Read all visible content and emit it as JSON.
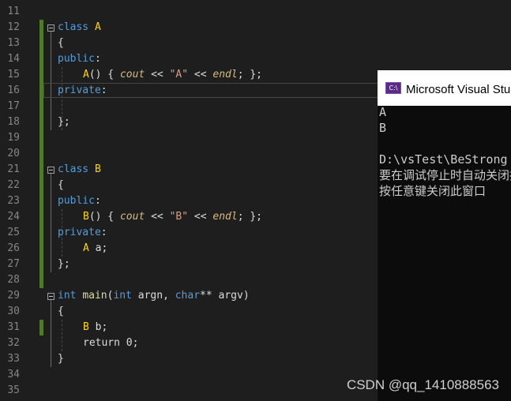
{
  "editor": {
    "lines": [
      {
        "num": "11"
      },
      {
        "num": "12",
        "tokens": [
          [
            "kw",
            "class"
          ],
          [
            "pn",
            " "
          ],
          [
            "yellow",
            "A"
          ]
        ]
      },
      {
        "num": "13",
        "tokens": [
          [
            "pn",
            "{"
          ]
        ]
      },
      {
        "num": "14",
        "tokens": [
          [
            "kw",
            "public"
          ],
          [
            "pn",
            ":"
          ]
        ]
      },
      {
        "num": "15",
        "tokens": [
          [
            "yellow",
            "A"
          ],
          [
            "pn",
            "() { "
          ],
          [
            "it",
            "cout"
          ],
          [
            "pn",
            " << "
          ],
          [
            "str",
            "\"A\""
          ],
          [
            "pn",
            " << "
          ],
          [
            "it",
            "endl"
          ],
          [
            "pn",
            "; };"
          ]
        ],
        "indent": 2
      },
      {
        "num": "16",
        "tokens": [
          [
            "kw",
            "private"
          ],
          [
            "pn",
            ":"
          ]
        ]
      },
      {
        "num": "17"
      },
      {
        "num": "18",
        "tokens": [
          [
            "pn",
            "};"
          ]
        ]
      },
      {
        "num": "19"
      },
      {
        "num": "20"
      },
      {
        "num": "21",
        "tokens": [
          [
            "kw",
            "class"
          ],
          [
            "pn",
            " "
          ],
          [
            "yellow",
            "B"
          ]
        ]
      },
      {
        "num": "22",
        "tokens": [
          [
            "pn",
            "{"
          ]
        ]
      },
      {
        "num": "23",
        "tokens": [
          [
            "kw",
            "public"
          ],
          [
            "pn",
            ":"
          ]
        ]
      },
      {
        "num": "24",
        "tokens": [
          [
            "yellow",
            "B"
          ],
          [
            "pn",
            "() { "
          ],
          [
            "it",
            "cout"
          ],
          [
            "pn",
            " << "
          ],
          [
            "str",
            "\"B\""
          ],
          [
            "pn",
            " << "
          ],
          [
            "it",
            "endl"
          ],
          [
            "pn",
            "; };"
          ]
        ],
        "indent": 2
      },
      {
        "num": "25",
        "tokens": [
          [
            "kw",
            "private"
          ],
          [
            "pn",
            ":"
          ]
        ]
      },
      {
        "num": "26",
        "tokens": [
          [
            "yellow",
            "A"
          ],
          [
            "pn",
            " a;"
          ]
        ],
        "indent": 2
      },
      {
        "num": "27",
        "tokens": [
          [
            "pn",
            "};"
          ]
        ]
      },
      {
        "num": "28"
      },
      {
        "num": "29",
        "tokens": [
          [
            "kw",
            "int"
          ],
          [
            "pn",
            " "
          ],
          [
            "fn",
            "main"
          ],
          [
            "pn",
            "("
          ],
          [
            "kw",
            "int"
          ],
          [
            "pn",
            " argn, "
          ],
          [
            "kw",
            "char"
          ],
          [
            "pn",
            "** argv)"
          ]
        ]
      },
      {
        "num": "30",
        "tokens": [
          [
            "pn",
            "{"
          ]
        ]
      },
      {
        "num": "31",
        "tokens": [
          [
            "yellow",
            "B"
          ],
          [
            "pn",
            " b;"
          ]
        ],
        "indent": 2
      },
      {
        "num": "32",
        "tokens": [
          [
            "pn",
            "return 0;"
          ]
        ],
        "indent": 2
      },
      {
        "num": "33",
        "tokens": [
          [
            "pn",
            "}"
          ]
        ]
      },
      {
        "num": "34"
      },
      {
        "num": "35"
      }
    ]
  },
  "console": {
    "title": "Microsoft Visual Studio 调试控制台",
    "icon_text": "C:\\",
    "lines": [
      "A",
      "B",
      "",
      "D:\\vsTest\\BeStrong",
      "要在调试停止时自动关闭控制台",
      "按任意键关闭此窗口"
    ]
  },
  "watermark": "CSDN @qq_1410888563"
}
